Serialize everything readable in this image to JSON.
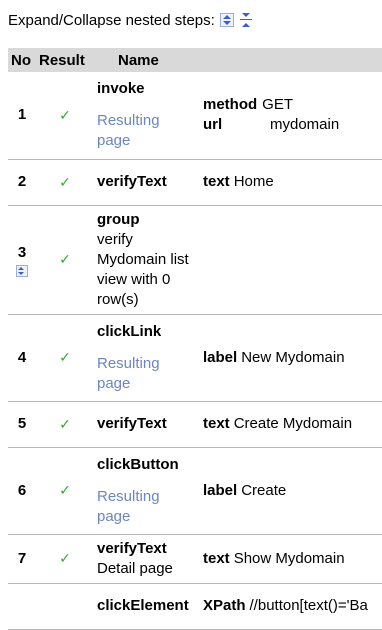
{
  "header": {
    "label": "Expand/Collapse nested steps:"
  },
  "table": {
    "columns": [
      "No",
      "Result",
      "Name"
    ],
    "rows": [
      {
        "no": "1",
        "result": "✓",
        "name": "invoke",
        "link": "Resulting page",
        "params": [
          {
            "key": "method",
            "value": "GET"
          },
          {
            "key": "url",
            "value": "mydomain"
          }
        ]
      },
      {
        "no": "2",
        "result": "✓",
        "name": "verifyText",
        "params": [
          {
            "key": "text",
            "value": "Home"
          }
        ]
      },
      {
        "no": "3",
        "result": "✓",
        "name": "group",
        "desc": "verify Mydomain list view with 0 row(s)"
      },
      {
        "no": "4",
        "result": "✓",
        "name": "clickLink",
        "link": "Resulting page",
        "params": [
          {
            "key": "label",
            "value": "New Mydomain"
          }
        ]
      },
      {
        "no": "5",
        "result": "✓",
        "name": "verifyText",
        "params": [
          {
            "key": "text",
            "value": "Create Mydomain"
          }
        ]
      },
      {
        "no": "6",
        "result": "✓",
        "name": "clickButton",
        "link": "Resulting page",
        "params": [
          {
            "key": "label",
            "value": "Create"
          }
        ]
      },
      {
        "no": "7",
        "result": "✓",
        "name": "verifyText",
        "desc": "Detail page",
        "params": [
          {
            "key": "text",
            "value": "Show Mydomain"
          }
        ]
      },
      {
        "no": "",
        "result": "",
        "name": "clickElement",
        "params": [
          {
            "key": "XPath",
            "value": "//button[text()='Ba"
          }
        ]
      }
    ]
  }
}
